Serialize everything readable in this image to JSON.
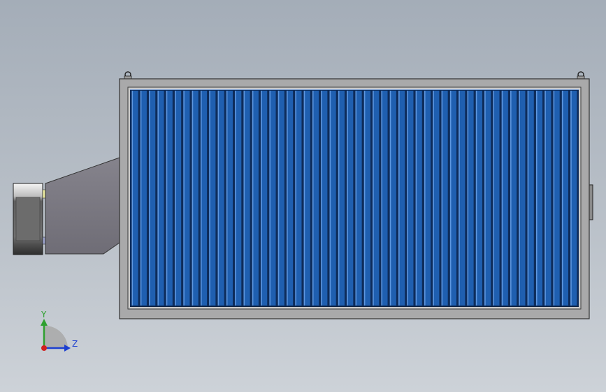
{
  "viewport": {
    "background_top": "#a4adb8",
    "background_bottom": "#cdd2d8"
  },
  "model": {
    "frame_color": "#a9a9aa",
    "frame_edge": "#3a3a3a",
    "panel_color": "#1f5fb0",
    "panel_highlight": "#5e97e0",
    "slat_count": 52,
    "transition_color": "#7d7b85",
    "motor_color": "#6f6f6f",
    "lifting_lugs": 2
  },
  "triad": {
    "y_label": "Y",
    "z_label": "Z",
    "y_color": "#2fa02f",
    "z_color": "#1c3fd0",
    "x_color": "#d02020"
  }
}
